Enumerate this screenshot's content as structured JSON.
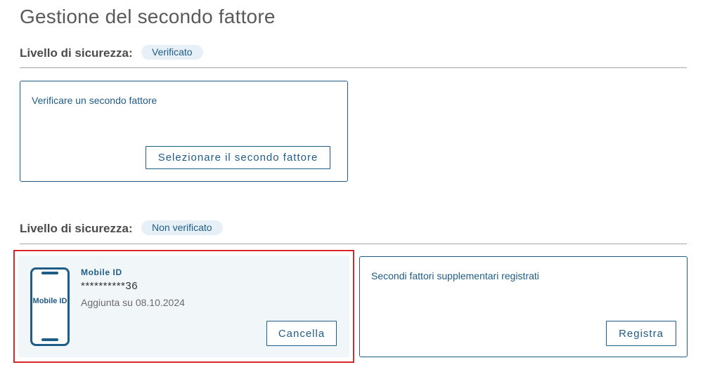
{
  "page": {
    "title": "Gestione del secondo fattore"
  },
  "section_verified": {
    "label": "Livello di sicurezza:",
    "badge": "Verificato",
    "card": {
      "title": "Verificare un secondo fattore",
      "button_label": "Selezionare il secondo fattore"
    }
  },
  "section_unverified": {
    "label": "Livello di sicurezza:",
    "badge": "Non verificato",
    "device": {
      "icon_text": "Mobile ID",
      "name": "Mobile ID",
      "number": "**********36",
      "added": "Aggiunta su 08.10.2024",
      "cancel_label": "Cancella"
    },
    "extra_card": {
      "title": "Secondi fattori supplementari registrati",
      "button_label": "Registra"
    }
  },
  "colors": {
    "accent": "#1f5c86",
    "badge_bg": "#e7f0f6",
    "highlight": "#d7262c",
    "device_card_bg": "#f1f6f9"
  }
}
